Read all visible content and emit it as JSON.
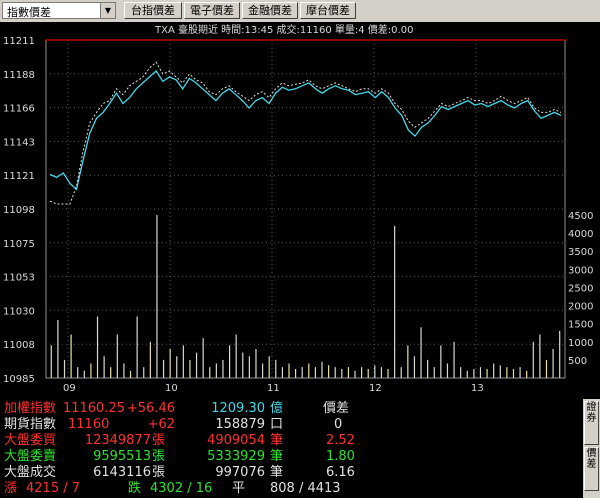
{
  "toolbar": {
    "dropdown_value": "指數價差",
    "buttons": [
      "台指價差",
      "電子價差",
      "金融價差",
      "摩台價差"
    ]
  },
  "info_line": "TXA  臺股期近  時間:13:45  成交:11160  單量:4  價差:0.00",
  "chart_data": {
    "type": "line",
    "y_left_ticks": [
      "11211",
      "11188",
      "11166",
      "11143",
      "11121",
      "11098",
      "11075",
      "11053",
      "11030",
      "11008",
      "10985"
    ],
    "y_right_ticks": [
      "4500",
      "4000",
      "3500",
      "3000",
      "2500",
      "2000",
      "1500",
      "1000",
      "500"
    ],
    "x_ticks": [
      "09",
      "10",
      "11",
      "12",
      "13"
    ],
    "price_range": [
      11098,
      11211
    ],
    "volume_range": [
      0,
      4500
    ],
    "series": [
      {
        "values": [
          11120,
          11118,
          11121,
          11114,
          11110,
          11130,
          11148,
          11158,
          11162,
          11168,
          11175,
          11168,
          11172,
          11178,
          11182,
          11186,
          11190,
          11183,
          11186,
          11184,
          11178,
          11185,
          11182,
          11178,
          11174,
          11170,
          11175,
          11178,
          11174,
          11170,
          11165,
          11170,
          11172,
          11168,
          11175,
          11179,
          11177,
          11178,
          11180,
          11182,
          11178,
          11175,
          11178,
          11180,
          11178,
          11177,
          11174,
          11175,
          11176,
          11172,
          11176,
          11172,
          11165,
          11160,
          11150,
          11146,
          11152,
          11155,
          11160,
          11166,
          11164,
          11166,
          11168,
          11170,
          11167,
          11168,
          11166,
          11168,
          11170,
          11167,
          11165,
          11168,
          11170,
          11163,
          11158,
          11160,
          11162,
          11160
        ]
      },
      {
        "values": [
          11102,
          11100,
          11100,
          11100,
          11112,
          11136,
          11155,
          11162,
          11168,
          11170,
          11178,
          11174,
          11180,
          11183,
          11186,
          11192,
          11196,
          11188,
          11190,
          11186,
          11182,
          11188,
          11184,
          11182,
          11176,
          11174,
          11178,
          11180,
          11176,
          11173,
          11170,
          11174,
          11176,
          11172,
          11178,
          11182,
          11180,
          11181,
          11182,
          11184,
          11180,
          11178,
          11180,
          11182,
          11180,
          11178,
          11176,
          11178,
          11178,
          11175,
          11178,
          11175,
          11168,
          11164,
          11156,
          11152,
          11155,
          11158,
          11163,
          11168,
          11166,
          11168,
          11170,
          11172,
          11170,
          11170,
          11168,
          11170,
          11173,
          11170,
          11168,
          11170,
          11172,
          11165,
          11162,
          11162,
          11164,
          11162
        ]
      }
    ],
    "volumes": [
      900,
      1600,
      500,
      1200,
      300,
      200,
      400,
      1700,
      600,
      300,
      1200,
      400,
      200,
      1700,
      300,
      1000,
      4500,
      500,
      800,
      600,
      900,
      500,
      700,
      1100,
      300,
      400,
      500,
      900,
      1200,
      700,
      600,
      800,
      400,
      600,
      500,
      300,
      400,
      250,
      300,
      400,
      300,
      450,
      350,
      300,
      250,
      300,
      200,
      300,
      250,
      350,
      300,
      250,
      4200,
      300,
      900,
      600,
      1400,
      500,
      300,
      900,
      400,
      1000,
      300,
      200,
      250,
      300,
      250,
      400,
      350,
      300,
      250,
      300,
      200,
      1000,
      1200,
      500,
      800,
      1300
    ]
  },
  "stats": [
    {
      "label": "加權指數",
      "v1": "11160.25",
      "v2": "+56.46",
      "v3": "1209.30",
      "u3": "億",
      "v4": "價差"
    },
    {
      "label": "期貨指數",
      "v1": "11160",
      "v2": "+62",
      "v3": "158879",
      "u3": "口",
      "v4": "0"
    },
    {
      "label": "大盤委買",
      "v1": "12349877",
      "u1": "張",
      "v3": "4909054",
      "u3": "筆",
      "v4": "2.52"
    },
    {
      "label": "大盤委賣",
      "v1": "9595513",
      "u1": "張",
      "v3": "5333929",
      "u3": "筆",
      "v4": "1.80"
    },
    {
      "label": "大盤成交",
      "v1": "6143116",
      "u1": "張",
      "v3": "997076",
      "u3": "筆",
      "v4": "6.16"
    }
  ],
  "breadth": {
    "up_label": "漲",
    "up": "4215 / 7",
    "down_label": "跌",
    "down": "4302 / 16",
    "flat_label": "平",
    "flat": "808 / 4413"
  },
  "side_tabs": [
    "證券",
    "價差"
  ],
  "colors": {
    "red": "#ff3030",
    "green": "#30e030",
    "cyan": "#40d8e8",
    "white": "#e0e0e0",
    "axis": "#c00000"
  }
}
